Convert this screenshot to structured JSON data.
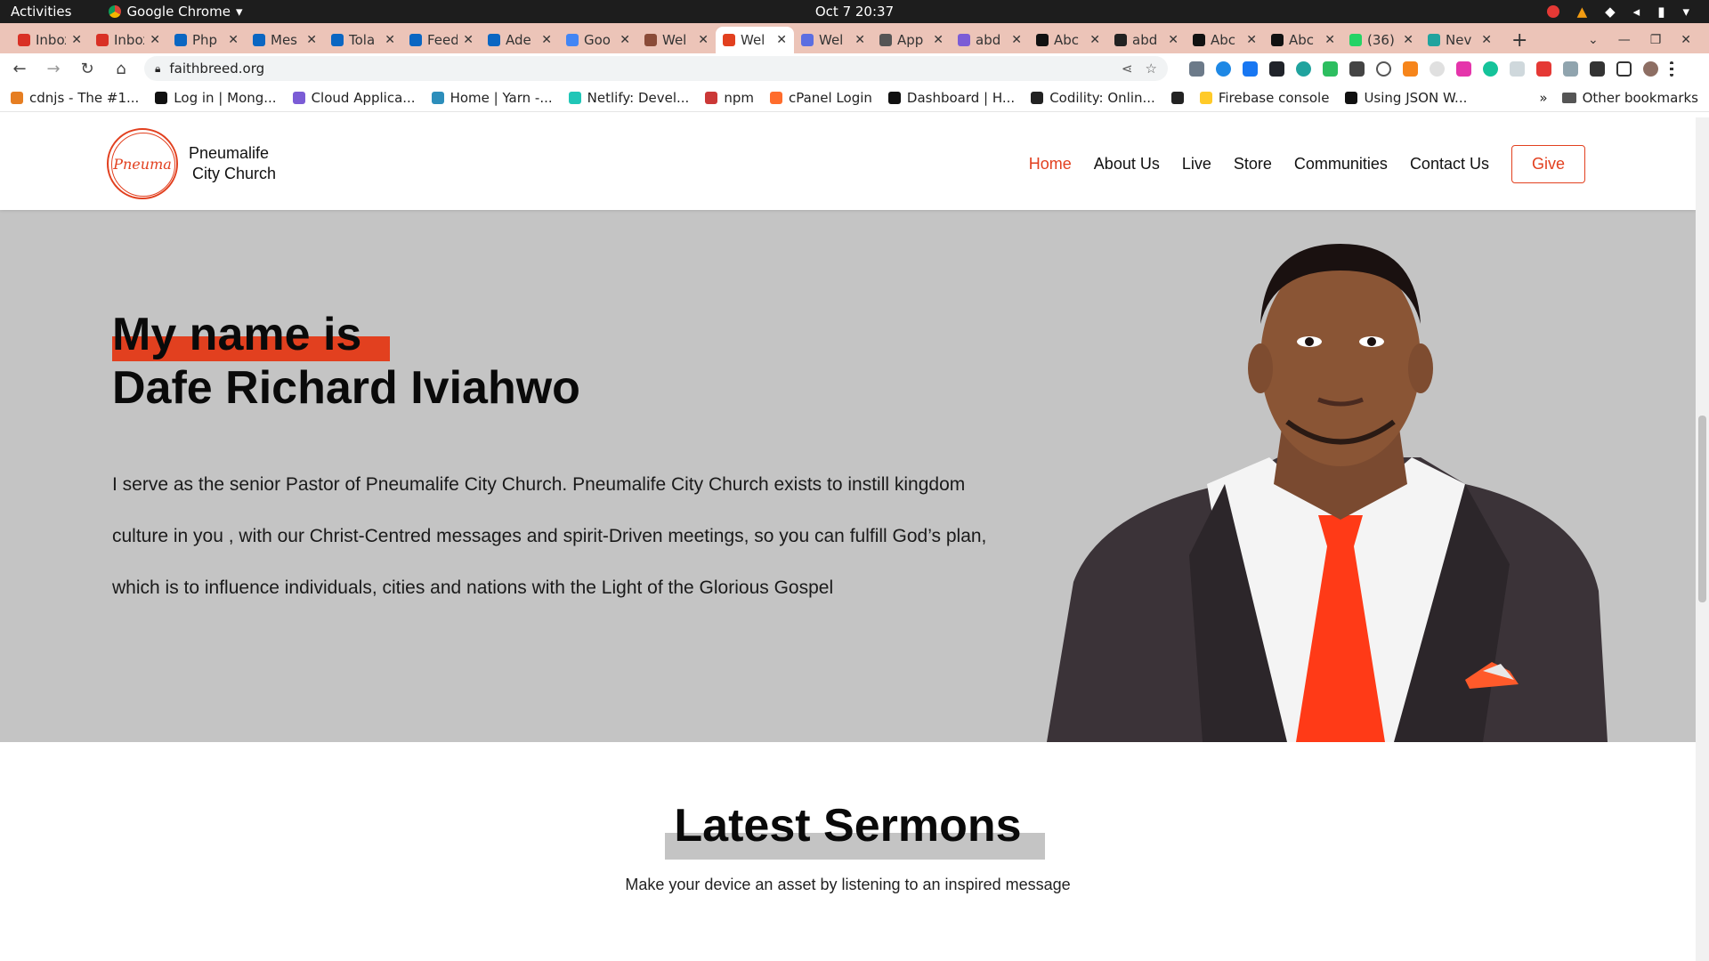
{
  "system": {
    "activities": "Activities",
    "app_name": "Google Chrome",
    "clock": "Oct 7  20:37"
  },
  "tabs": [
    {
      "title": "Inbox",
      "color": "#d93025"
    },
    {
      "title": "Inbox",
      "color": "#d93025"
    },
    {
      "title": "Php",
      "color": "#0a66c2"
    },
    {
      "title": "Mes",
      "color": "#0a66c2"
    },
    {
      "title": "Tola",
      "color": "#0a66c2"
    },
    {
      "title": "Feed",
      "color": "#0a66c2"
    },
    {
      "title": "Ade",
      "color": "#0a66c2"
    },
    {
      "title": "Goo",
      "color": "#4285f4"
    },
    {
      "title": "Wel",
      "color": "#8a4b38"
    },
    {
      "title": "Wel",
      "color": "#e2401f",
      "active": true
    },
    {
      "title": "Wel",
      "color": "#5b6ee1"
    },
    {
      "title": "App",
      "color": "#555555"
    },
    {
      "title": "abd",
      "color": "#7b5cd6"
    },
    {
      "title": "Abc",
      "color": "#111111"
    },
    {
      "title": "abd",
      "color": "#222222"
    },
    {
      "title": "Abc",
      "color": "#111111"
    },
    {
      "title": "Abc",
      "color": "#111111"
    },
    {
      "title": "(36)",
      "color": "#25d366"
    },
    {
      "title": "Nev",
      "color": "#20a39e"
    }
  ],
  "address_bar": {
    "url": "faithbreed.org"
  },
  "bookmarks": [
    {
      "label": "cdnjs - The #1...",
      "color": "#e67e22"
    },
    {
      "label": "Log in | Mong...",
      "color": "#111111"
    },
    {
      "label": "Cloud Applica...",
      "color": "#7b5cd6"
    },
    {
      "label": "Home | Yarn -...",
      "color": "#2c8ebb"
    },
    {
      "label": "Netlify: Devel...",
      "color": "#20c6b7"
    },
    {
      "label": "npm",
      "color": "#cb3837"
    },
    {
      "label": "cPanel Login",
      "color": "#ff6c2c"
    },
    {
      "label": "Dashboard | H...",
      "color": "#111111"
    },
    {
      "label": "Codility: Onlin...",
      "color": "#222222"
    },
    {
      "label": "",
      "color": "#222222"
    },
    {
      "label": "Firebase console",
      "color": "#ffca28"
    },
    {
      "label": "Using JSON W...",
      "color": "#111111"
    }
  ],
  "bookmarks_more": "»",
  "other_bookmarks": "Other bookmarks",
  "site": {
    "brand_line1": "Pneumalife",
    "brand_line2": "City Church",
    "logo_text": "Pneuma",
    "nav": [
      "Home",
      "About Us",
      "Live",
      "Store",
      "Communities",
      "Contact Us"
    ],
    "give": "Give",
    "accent": "#e2401f"
  },
  "hero": {
    "heading_line1": "My name is",
    "heading_line2": "Dafe Richard Iviahwo",
    "body": "I serve as the senior Pastor of Pneumalife City Church. Pneumalife City Church exists to instill kingdom culture in you , with our Christ-Centred messages and spirit-Driven meetings, so you can fulfill God’s plan, which is to influence individuals, cities and nations with the Light of the Glorious Gospel"
  },
  "sermons": {
    "title": "Latest Sermons",
    "subtitle": "Make your device an asset by listening to an inspired message"
  }
}
